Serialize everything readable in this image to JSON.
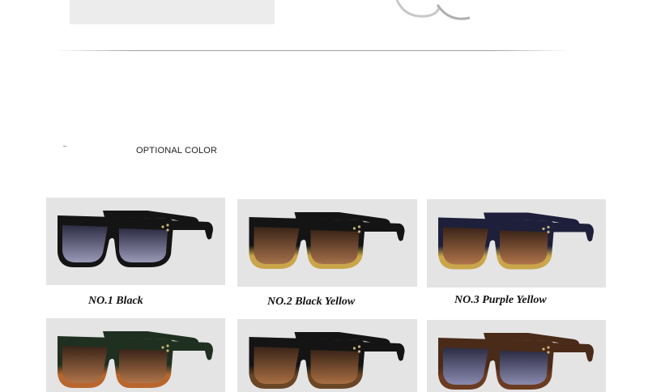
{
  "section": {
    "title": "OPTIONAL COLOR"
  },
  "products": [
    {
      "label": "NO.1 Black",
      "icon": "sunglasses-icon",
      "frame_top": "#141414",
      "frame_bottom": "#141414",
      "lens_top": "#2c2c44",
      "lens_bottom": "#9a9ab8"
    },
    {
      "label": "NO.2 Black Yellow",
      "icon": "sunglasses-icon",
      "frame_top": "#141414",
      "frame_bottom": "#c9a64a",
      "lens_top": "#3a2418",
      "lens_bottom": "#a5704a"
    },
    {
      "label": "NO.3 Purple Yellow",
      "icon": "sunglasses-icon",
      "frame_top": "#1e1f3a",
      "frame_bottom": "#c9a64a",
      "lens_top": "#3a2418",
      "lens_bottom": "#b0744a"
    },
    {
      "label": "",
      "icon": "sunglasses-icon",
      "frame_top": "#1f3020",
      "frame_bottom": "#b9662e",
      "lens_top": "#3a2418",
      "lens_bottom": "#b0744a"
    },
    {
      "label": "",
      "icon": "sunglasses-icon",
      "frame_top": "#141414",
      "frame_bottom": "#6a4626",
      "lens_top": "#3a2418",
      "lens_bottom": "#a86e42"
    },
    {
      "label": "",
      "icon": "sunglasses-icon",
      "frame_top": "#4a2a18",
      "frame_bottom": "#6b3c22",
      "lens_top": "#2c2c44",
      "lens_bottom": "#8a8ab0"
    }
  ]
}
